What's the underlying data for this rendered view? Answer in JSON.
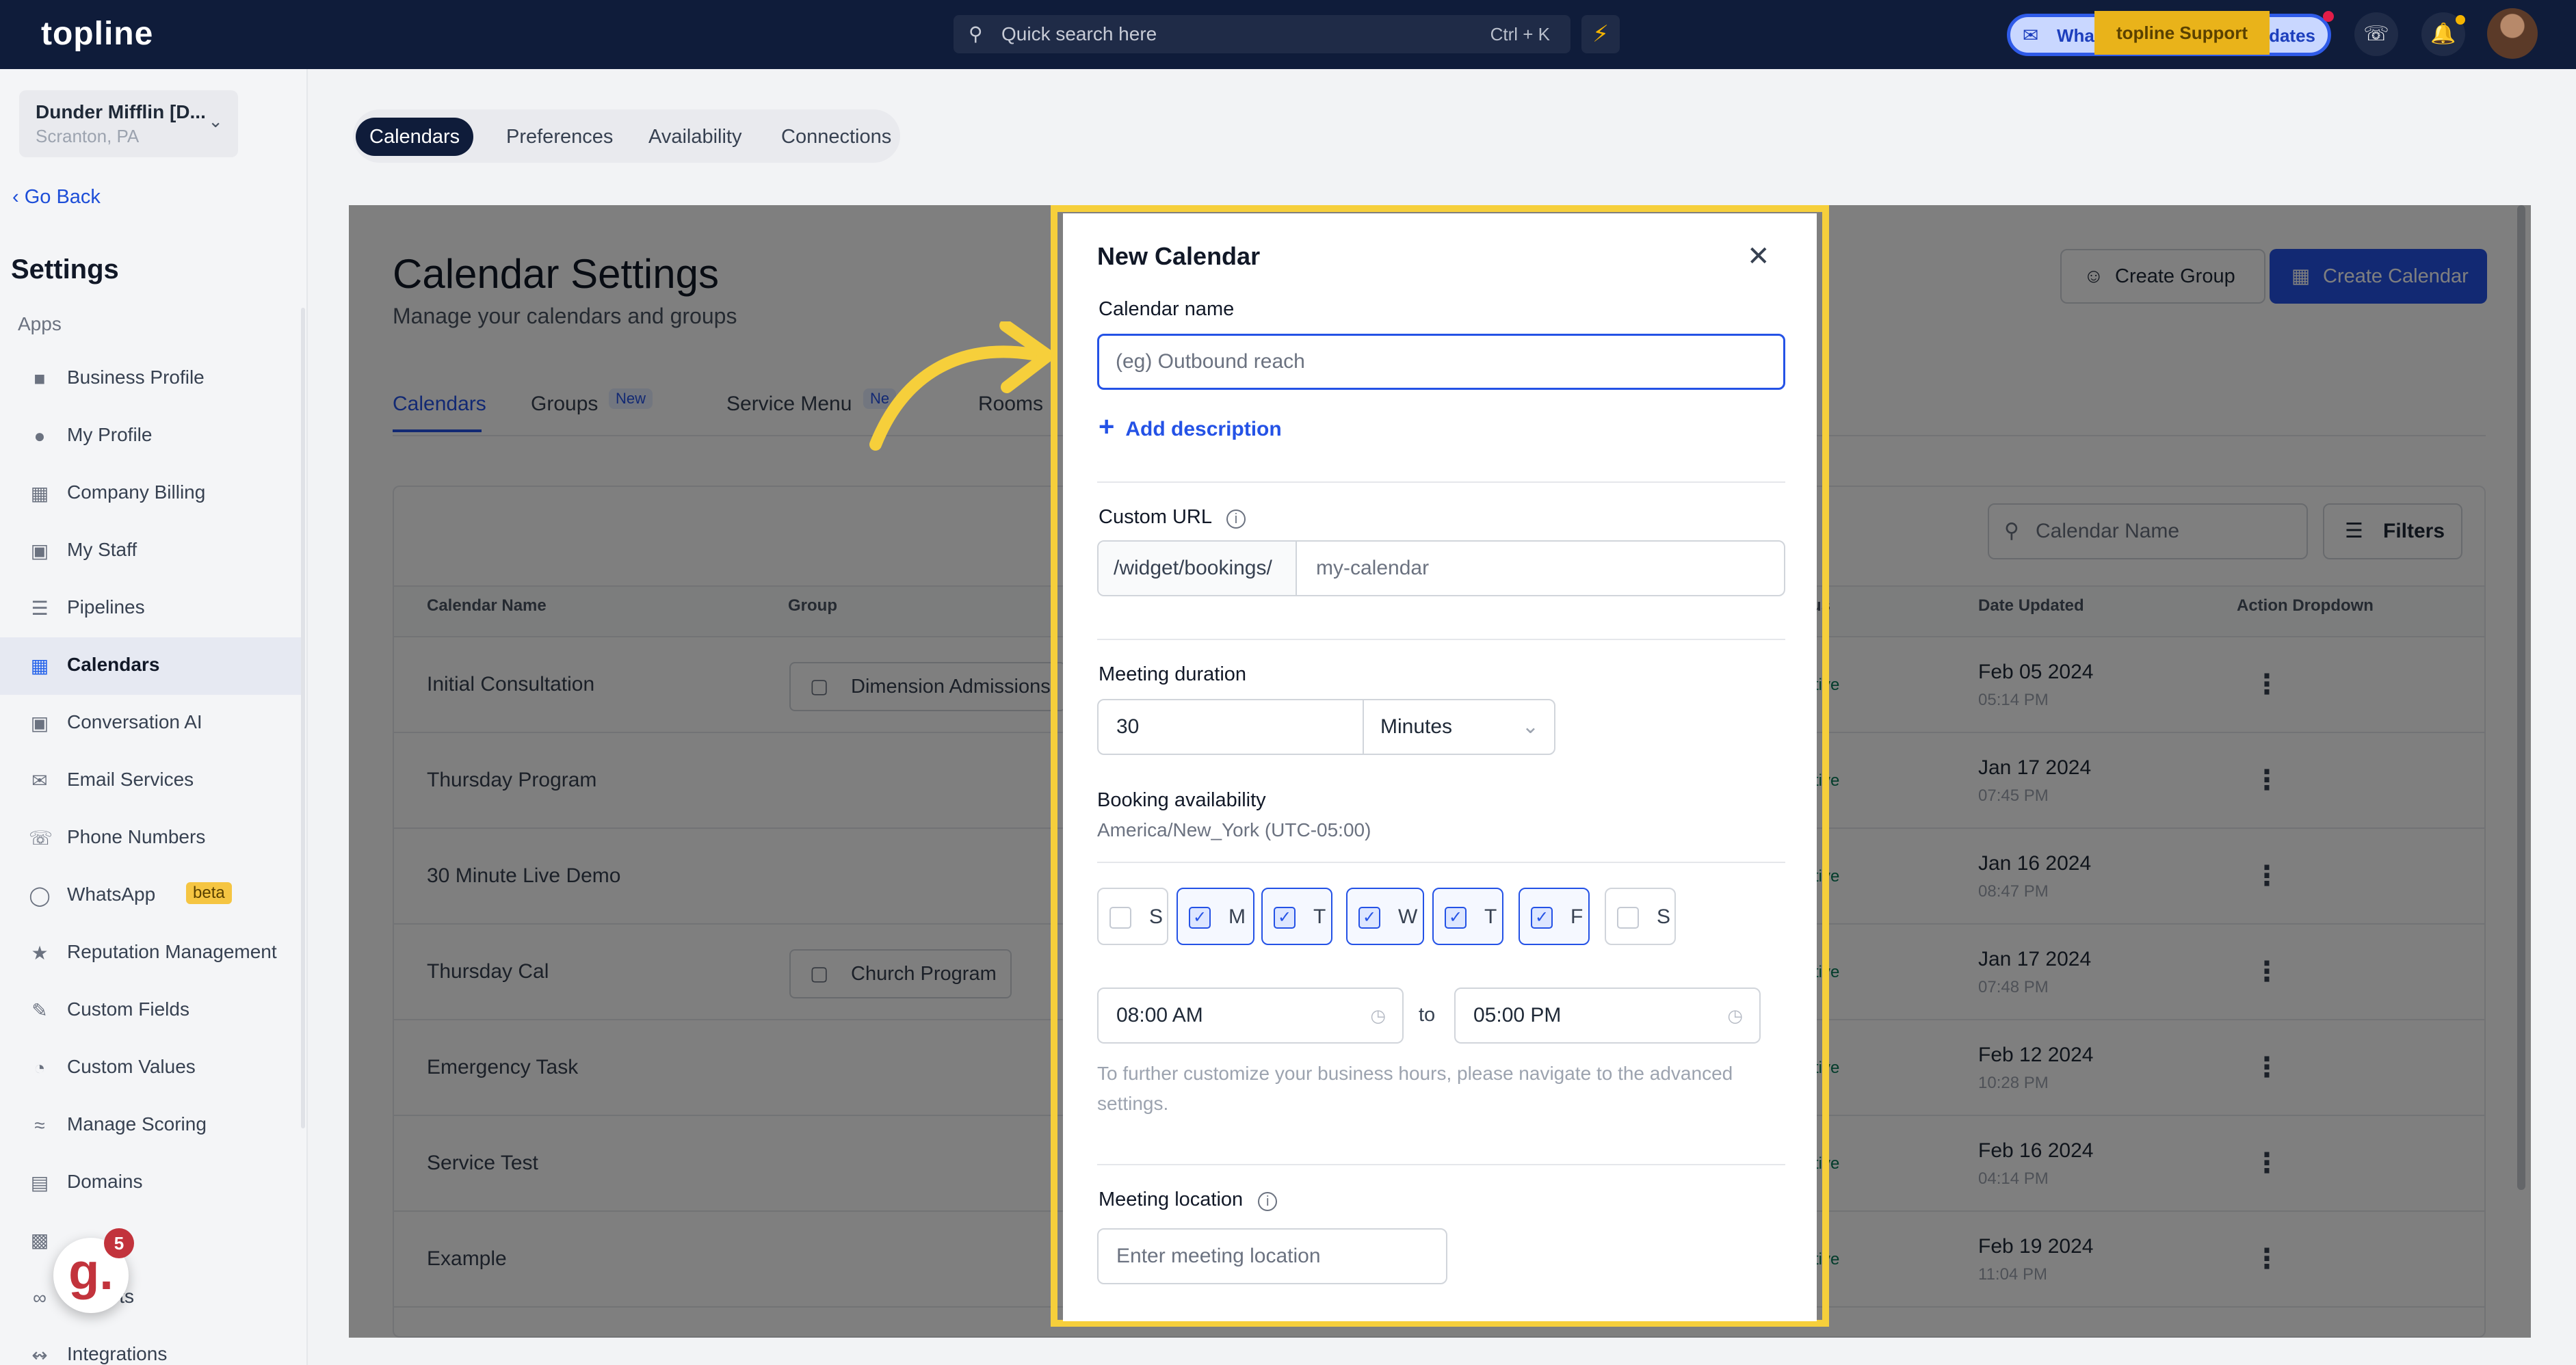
{
  "topbar": {
    "logo": "topline",
    "search_placeholder": "Quick search here",
    "search_shortcut": "Ctrl + K",
    "whats_new_left": "What",
    "whats_new_right": "dates",
    "support_label": "topline Support",
    "icons": [
      "search-icon",
      "bolt-icon",
      "chat-icon",
      "phone-icon",
      "bell-icon"
    ]
  },
  "sidebar": {
    "account_name": "Dunder Mifflin [D...",
    "account_location": "Scranton, PA",
    "go_back": "Go Back",
    "settings_title": "Settings",
    "section_label": "Apps",
    "items": [
      {
        "label": "Business Profile",
        "icon": "briefcase-icon"
      },
      {
        "label": "My Profile",
        "icon": "user-icon"
      },
      {
        "label": "Company Billing",
        "icon": "grid-icon"
      },
      {
        "label": "My Staff",
        "icon": "staff-icon"
      },
      {
        "label": "Pipelines",
        "icon": "pipeline-icon"
      },
      {
        "label": "Calendars",
        "icon": "calendar-icon",
        "active": true
      },
      {
        "label": "Conversation AI",
        "icon": "chat-bubbles-icon"
      },
      {
        "label": "Email Services",
        "icon": "mail-icon"
      },
      {
        "label": "Phone Numbers",
        "icon": "phone-icon"
      },
      {
        "label": "WhatsApp",
        "icon": "whatsapp-icon",
        "badge": "beta"
      },
      {
        "label": "Reputation Management",
        "icon": "star-icon"
      },
      {
        "label": "Custom Fields",
        "icon": "edit-icon"
      },
      {
        "label": "Custom Values",
        "icon": "pie-icon"
      },
      {
        "label": "Manage Scoring",
        "icon": "chart-icon"
      },
      {
        "label": "Domains",
        "icon": "domain-icon"
      },
      {
        "label": "",
        "icon": "media-icon"
      },
      {
        "label": "edirects",
        "icon": "link-icon"
      },
      {
        "label": "Integrations",
        "icon": "integrations-icon"
      }
    ],
    "gleap_letter": "g.",
    "gleap_count": "5"
  },
  "tabs": [
    "Calendars",
    "Preferences",
    "Availability",
    "Connections"
  ],
  "page": {
    "title": "Calendar Settings",
    "subtitle": "Manage your calendars and groups",
    "create_group": "Create Group",
    "create_calendar": "Create Calendar",
    "subtabs": [
      "Calendars",
      "Groups",
      "Service Menu",
      "Rooms"
    ],
    "new_tag": "New",
    "new_tag_partial": "Ne",
    "search_placeholder": "Calendar Name",
    "filters": "Filters",
    "columns": [
      "Calendar Name",
      "Group",
      "tus",
      "Date Updated",
      "Action Dropdown"
    ],
    "rows": [
      {
        "name": "Initial Consultation",
        "group": "Dimension Admissions",
        "status": "ctive",
        "date": "Feb 05 2024",
        "time": "05:14 PM"
      },
      {
        "name": "Thursday Program",
        "group": "",
        "status": "ctive",
        "date": "Jan 17 2024",
        "time": "07:45 PM"
      },
      {
        "name": "30 Minute Live Demo",
        "group": "",
        "status": "ctive",
        "date": "Jan 16 2024",
        "time": "08:47 PM"
      },
      {
        "name": "Thursday Cal",
        "group": "Church Program",
        "status": "ctive",
        "date": "Jan 17 2024",
        "time": "07:48 PM"
      },
      {
        "name": "Emergency Task",
        "group": "",
        "status": "ctive",
        "date": "Feb 12 2024",
        "time": "10:28 PM"
      },
      {
        "name": "Service Test",
        "group": "",
        "status": "ctive",
        "date": "Feb 16 2024",
        "time": "04:14 PM"
      },
      {
        "name": "Example",
        "group": "",
        "status": "ctive",
        "date": "Feb 19 2024",
        "time": "11:04 PM"
      }
    ]
  },
  "modal": {
    "title": "New Calendar",
    "calendar_name_label": "Calendar name",
    "calendar_name_placeholder": "(eg) Outbound reach",
    "add_description": "Add description",
    "custom_url_label": "Custom URL",
    "url_prefix": "/widget/bookings/",
    "url_placeholder": "my-calendar",
    "duration_label": "Meeting duration",
    "duration_value": "30",
    "duration_unit": "Minutes",
    "availability_label": "Booking availability",
    "timezone": "America/New_York (UTC-05:00)",
    "days": [
      {
        "label": "S",
        "checked": false
      },
      {
        "label": "M",
        "checked": true
      },
      {
        "label": "T",
        "checked": true
      },
      {
        "label": "W",
        "checked": true
      },
      {
        "label": "T",
        "checked": true
      },
      {
        "label": "F",
        "checked": true
      },
      {
        "label": "S",
        "checked": false
      }
    ],
    "start_time": "08:00 AM",
    "to_label": "to",
    "end_time": "05:00 PM",
    "hint": "To further customize your business hours, please navigate to the advanced settings.",
    "location_label": "Meeting location",
    "location_placeholder": "Enter meeting location"
  },
  "colors": {
    "accent": "#2452e6",
    "highlight": "#f6cf3b",
    "topbar": "#0f1c3a"
  }
}
